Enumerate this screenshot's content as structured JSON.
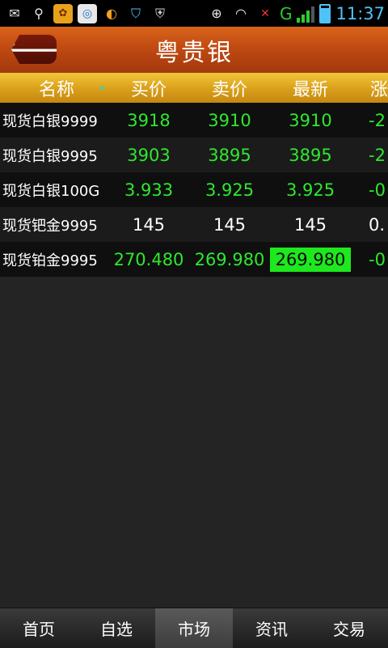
{
  "status_bar": {
    "time": "11:37",
    "network_label": "G",
    "icons_left": [
      "mail-icon",
      "usb-icon",
      "app-icon",
      "camera-icon",
      "sync-icon",
      "shield-icon",
      "shield-browser-icon"
    ],
    "icons_right": [
      "dialpad-icon",
      "wifi-icon",
      "signal-icon",
      "battery-icon"
    ]
  },
  "title_bar": {
    "back_symbol": "🡐",
    "title": "粤贵银"
  },
  "table": {
    "headers": {
      "name": "名称",
      "more": "»",
      "buy": "买价",
      "sell": "卖价",
      "last": "最新",
      "change": "涨"
    },
    "rows": [
      {
        "name": "现货白银9999",
        "buy": "3918",
        "sell": "3910",
        "last": "3910",
        "change": "-2"
      },
      {
        "name": "现货白银9995",
        "buy": "3903",
        "sell": "3895",
        "last": "3895",
        "change": "-2"
      },
      {
        "name": "现货白银100G",
        "buy": "3.933",
        "sell": "3.925",
        "last": "3.925",
        "change": "-0"
      },
      {
        "name": "现货钯金9995",
        "buy": "145",
        "sell": "145",
        "last": "145",
        "change": "0."
      },
      {
        "name": "现货铂金9995",
        "buy": "270.480",
        "sell": "269.980",
        "last": "269.980",
        "change": "-0"
      }
    ]
  },
  "bottom_nav": {
    "items": [
      "首页",
      "自选",
      "市场",
      "资讯",
      "交易"
    ],
    "active": "市场"
  },
  "colors": {
    "price_up": "#2ee82e",
    "flash_bg": "#1ee81e",
    "header_gold": "#dca21c",
    "title_orange": "#c14a12"
  }
}
